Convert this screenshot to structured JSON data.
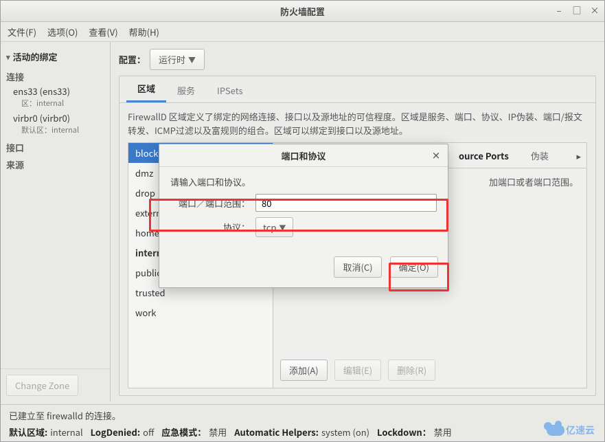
{
  "window": {
    "title": "防火墙配置"
  },
  "menu": {
    "file": "文件(F)",
    "options": "选项(O)",
    "view": "查看(V)",
    "help": "帮助(H)"
  },
  "sidebar": {
    "heading": "活动的绑定",
    "conn_label": "连接",
    "iface_label": "接口",
    "src_label": "来源",
    "items": [
      {
        "name": "ens33 (ens33)",
        "zone": "区：internal"
      },
      {
        "name": "virbr0 (virbr0)",
        "zone": "默认区：internal"
      }
    ],
    "change_zone": "Change Zone"
  },
  "config": {
    "label": "配置：",
    "value": "运行时"
  },
  "tabs": {
    "zones": "区域",
    "services": "服务",
    "ipsets": "IPSets"
  },
  "zone_desc": "FirewallD 区域定义了绑定的网络连接、接口以及源地址的可信程度。区域是服务、端口、协议、IP伪装、端口/报文转发、ICMP过滤以及富规则的组合。区域可以绑定到接口以及源地址。",
  "zones": [
    "block",
    "dmz",
    "drop",
    "external",
    "home",
    "internal",
    "public",
    "trusted",
    "work"
  ],
  "zone_selected": "block",
  "zone_current": "internal",
  "detail_tabs": {
    "source_ports": "ource Ports",
    "masq": "伪装"
  },
  "detail_hint": "加端口或者端口范围。",
  "detail_btns": {
    "add": "添加(A)",
    "edit": "编辑(E)",
    "delete": "删除(R)"
  },
  "modal": {
    "title": "端口和协议",
    "hint": "请输入端口和协议。",
    "port_label": "端口／端口范围：",
    "port_value": "80",
    "proto_label": "协议：",
    "proto_value": "tcp",
    "cancel": "取消(C)",
    "ok": "确定(O)"
  },
  "status": {
    "line1": "已建立至  firewalld 的连接。",
    "dz_l": "默认区域:",
    "dz_v": "internal",
    "ld_l": "LogDenied:",
    "ld_v": "off",
    "em_l": "应急模式：",
    "em_v": "禁用",
    "ah_l": "Automatic Helpers:",
    "ah_v": "system (on)",
    "lk_l": "Lockdown：",
    "lk_v": "禁用"
  },
  "logo": "亿速云"
}
